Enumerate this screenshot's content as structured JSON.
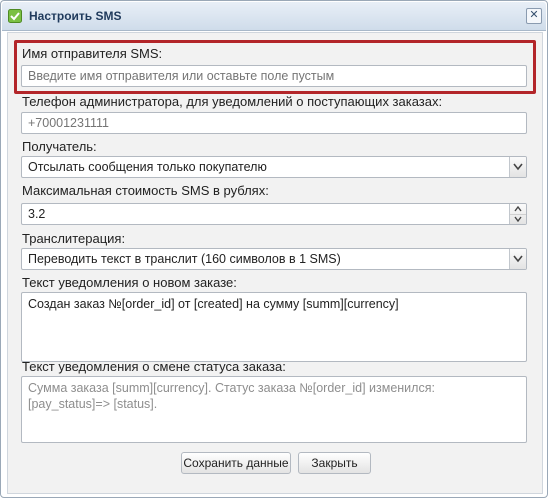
{
  "window": {
    "title": "Настроить SMS",
    "close_glyph": "✕",
    "icon": "settings-window-icon"
  },
  "form": {
    "sender": {
      "label": "Имя отправителя SMS:",
      "value": "",
      "placeholder": "Введите имя отправителя или оставьте поле пустым",
      "highlight_color": "#b3262a"
    },
    "admin_phone": {
      "label": "Телефон администратора, для уведомлений о поступающих заказах:",
      "value": "",
      "placeholder": "+70001231111"
    },
    "recipient": {
      "label": "Получатель:",
      "selected": "Отсылать сообщения только покупателю"
    },
    "max_cost": {
      "label": "Максимальная стоимость SMS в рублях:",
      "value": "3.2"
    },
    "transliteration": {
      "label": "Транслитерация:",
      "selected": "Переводить текст в транслит (160 символов в 1 SMS)"
    },
    "new_order_text": {
      "label": "Текст уведомления о новом заказе:",
      "value": "Создан заказ №[order_id] от [created] на сумму [summ][currency]"
    },
    "status_change_text": {
      "label": "Текст уведомления о смене статуса заказа:",
      "value": "Сумма заказа [summ][currency]. Статус заказа №[order_id] изменился: [pay_status]=> [status]."
    }
  },
  "buttons": {
    "save_label": "Сохранить данные",
    "close_label": "Закрыть"
  }
}
